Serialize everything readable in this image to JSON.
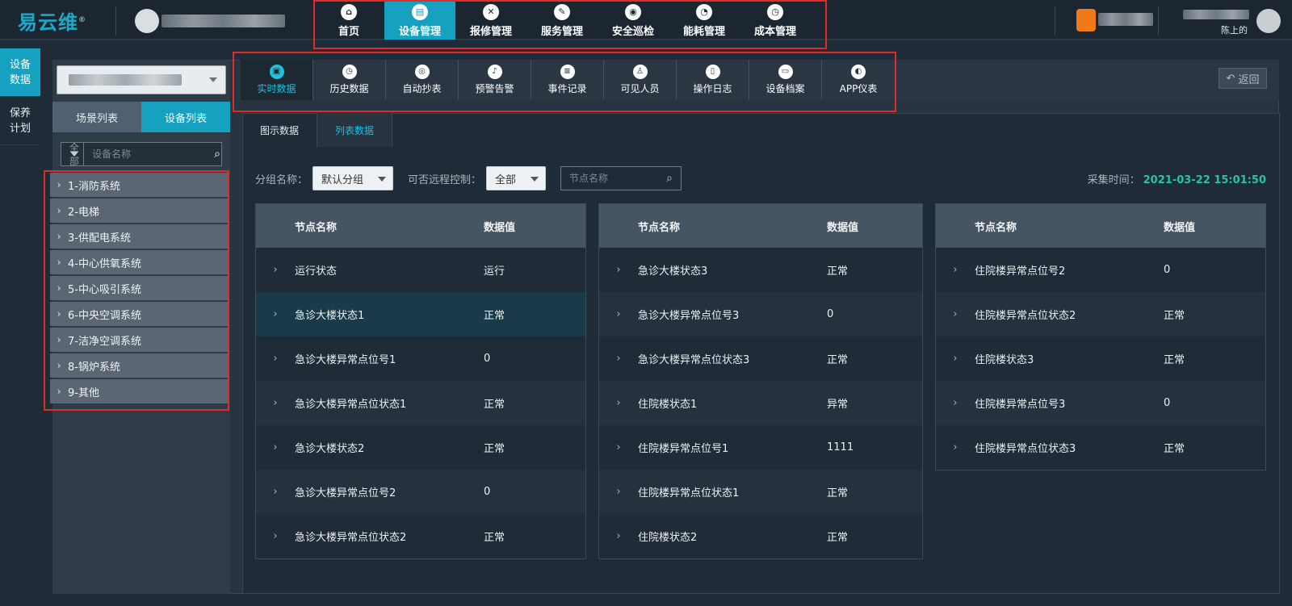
{
  "app": {
    "logo": "易云维",
    "logo_mark": "®"
  },
  "header": {
    "nav": [
      {
        "label": "首页",
        "icon": "home-icon",
        "glyph": "⌂",
        "active": false
      },
      {
        "label": "设备管理",
        "icon": "device-icon",
        "glyph": "▤",
        "active": true
      },
      {
        "label": "报修管理",
        "icon": "tools-icon",
        "glyph": "✕",
        "active": false
      },
      {
        "label": "服务管理",
        "icon": "edit-icon",
        "glyph": "✎",
        "active": false
      },
      {
        "label": "安全巡检",
        "icon": "location-icon",
        "glyph": "◉",
        "active": false
      },
      {
        "label": "能耗管理",
        "icon": "pie-chart-icon",
        "glyph": "◔",
        "active": false
      },
      {
        "label": "成本管理",
        "icon": "timer-icon",
        "glyph": "◷",
        "active": false
      }
    ],
    "user_name": "陈上的"
  },
  "rail": [
    {
      "label_line1": "设备",
      "label_line2": "数据",
      "active": true
    },
    {
      "label_line1": "保养",
      "label_line2": "计划",
      "active": false
    }
  ],
  "left_panel": {
    "tabs": [
      {
        "label": "场景列表",
        "active": false
      },
      {
        "label": "设备列表",
        "active": true
      }
    ],
    "filter_value": "全部",
    "search_placeholder": "设备名称",
    "tree": [
      "1-消防系统",
      "2-电梯",
      "3-供配电系统",
      "4-中心供氧系统",
      "5-中心吸引系统",
      "6-中央空调系统",
      "7-洁净空调系统",
      "8-锅炉系统",
      "9-其他"
    ]
  },
  "subnav": {
    "items": [
      {
        "label": "实时数据",
        "icon": "realtime-icon",
        "glyph": "▣",
        "active": true
      },
      {
        "label": "历史数据",
        "icon": "history-icon",
        "glyph": "◷",
        "active": false
      },
      {
        "label": "自动抄表",
        "icon": "meter-icon",
        "glyph": "◎",
        "active": false
      },
      {
        "label": "预警告警",
        "icon": "bell-icon",
        "glyph": "♪",
        "active": false
      },
      {
        "label": "事件记录",
        "icon": "record-icon",
        "glyph": "≡",
        "active": false
      },
      {
        "label": "可见人员",
        "icon": "person-icon",
        "glyph": "♙",
        "active": false
      },
      {
        "label": "操作日志",
        "icon": "log-icon",
        "glyph": "▯",
        "active": false
      },
      {
        "label": "设备档案",
        "icon": "archive-icon",
        "glyph": "▭",
        "active": false
      },
      {
        "label": "APP仪表",
        "icon": "gauge-icon",
        "glyph": "◐",
        "active": false
      }
    ],
    "back_label": "返回"
  },
  "content": {
    "tabs": [
      {
        "label": "图示数据",
        "active": false
      },
      {
        "label": "列表数据",
        "active": true
      }
    ],
    "group_label": "分组名称：",
    "group_value": "默认分组",
    "remote_label": "可否远程控制：",
    "remote_value": "全部",
    "node_search_placeholder": "节点名称",
    "collect_time_label": "采集时间：",
    "collect_time_value": "2021-03-22 15:01:50"
  },
  "tables": [
    {
      "col_name": "节点名称",
      "col_value": "数据值",
      "rows": [
        {
          "name": "运行状态",
          "value": "运行"
        },
        {
          "name": "急诊大楼状态1",
          "value": "正常"
        },
        {
          "name": "急诊大楼异常点位号1",
          "value": "0"
        },
        {
          "name": "急诊大楼异常点位状态1",
          "value": "正常"
        },
        {
          "name": "急诊大楼状态2",
          "value": "正常"
        },
        {
          "name": "急诊大楼异常点位号2",
          "value": "0"
        },
        {
          "name": "急诊大楼异常点位状态2",
          "value": "正常"
        }
      ]
    },
    {
      "col_name": "节点名称",
      "col_value": "数据值",
      "rows": [
        {
          "name": "急诊大楼状态3",
          "value": "正常"
        },
        {
          "name": "急诊大楼异常点位号3",
          "value": "0"
        },
        {
          "name": "急诊大楼异常点位状态3",
          "value": "正常"
        },
        {
          "name": "住院楼状态1",
          "value": "异常"
        },
        {
          "name": "住院楼异常点位号1",
          "value": "1111"
        },
        {
          "name": "住院楼异常点位状态1",
          "value": "正常"
        },
        {
          "name": "住院楼状态2",
          "value": "正常"
        }
      ]
    },
    {
      "col_name": "节点名称",
      "col_value": "数据值",
      "rows": [
        {
          "name": "住院楼异常点位号2",
          "value": "0"
        },
        {
          "name": "住院楼异常点位状态2",
          "value": "正常"
        },
        {
          "name": "住院楼状态3",
          "value": "正常"
        },
        {
          "name": "住院楼异常点位号3",
          "value": "0"
        },
        {
          "name": "住院楼异常点位状态3",
          "value": "正常"
        }
      ]
    }
  ],
  "colors": {
    "accent": "#15a1bf",
    "highlight_text": "#1ec0e0",
    "time_text": "#21c6a4",
    "annotation_red": "#e02b2b"
  }
}
